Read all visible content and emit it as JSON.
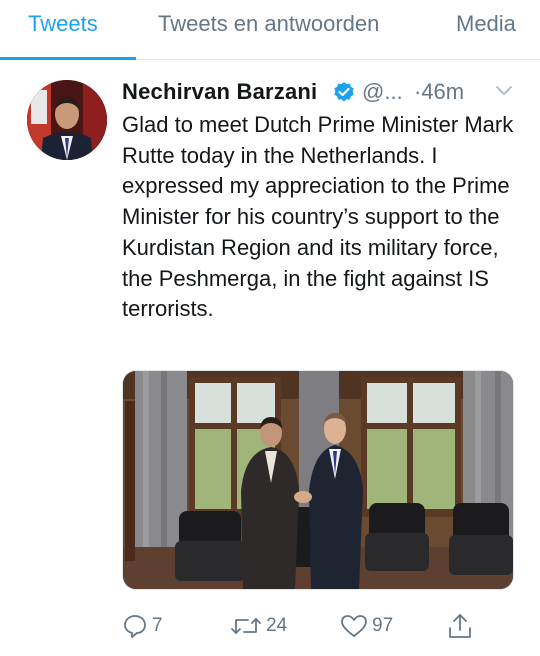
{
  "tabs": [
    {
      "label": "Tweets",
      "active": true
    },
    {
      "label": "Tweets en antwoorden",
      "active": false
    },
    {
      "label": "Media",
      "active": false
    }
  ],
  "tweet": {
    "author_name": "Nechirvan Barzani",
    "handle": "@...",
    "time": "·46m",
    "verified": true,
    "text": "Glad to meet Dutch Prime Minister Mark Rutte today in the Netherlands. I expressed my appreciation to the Prime Minister for his country’s support to the Kurdistan Region and its military force, the Peshmerga, in the fight against IS terrorists.",
    "reply_count": "7",
    "retweet_count": "24",
    "like_count": "97"
  },
  "colors": {
    "accent": "#1da1f2",
    "secondary_text": "#657786",
    "primary_text": "#14171a",
    "divider": "#e1e8ed"
  },
  "icons": [
    "verified-badge-icon",
    "chevron-down-icon",
    "reply-icon",
    "retweet-icon",
    "like-icon",
    "share-icon"
  ]
}
